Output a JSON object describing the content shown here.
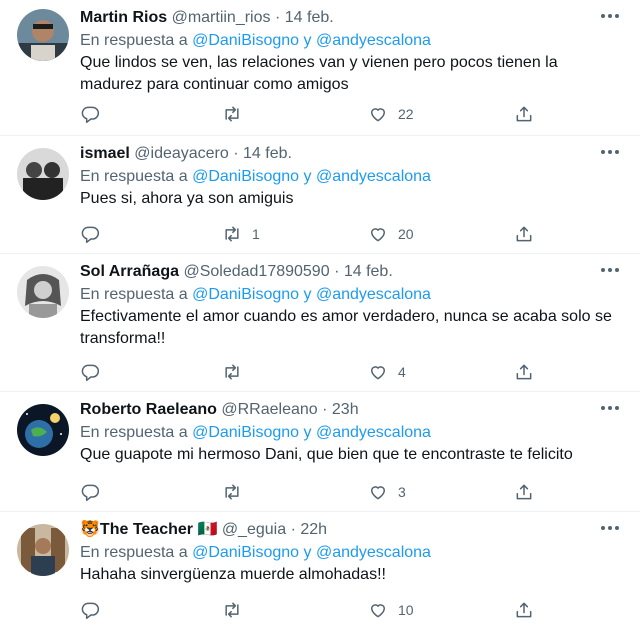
{
  "replies": [
    {
      "name": "Martin Rios",
      "handle": "@martiin_rios",
      "dot": "·",
      "time": "14 feb.",
      "reply_prefix": "En respuesta a",
      "mention1": "@DaniBisogno",
      "reply_and": "y",
      "mention2": "@andyescalona",
      "text": "Que lindos se ven, las relaciones van y vienen pero pocos tienen la madurez para continuar como amigos",
      "retweets": "",
      "likes": "22",
      "avatar_color": "#3a3a3a"
    },
    {
      "name": "ismael",
      "handle": "@ideayacero",
      "dot": "·",
      "time": "14 feb.",
      "reply_prefix": "En respuesta a",
      "mention1": "@DaniBisogno",
      "reply_and": "y",
      "mention2": "@andyescalona",
      "text": "Pues si, ahora ya son amiguis",
      "retweets": "1",
      "likes": "20",
      "avatar_color": "#2b2b2b"
    },
    {
      "name": "Sol Arrañaga",
      "handle": "@Soledad17890590",
      "dot": "·",
      "time": "14 feb.",
      "reply_prefix": "En respuesta a",
      "mention1": "@DaniBisogno",
      "reply_and": "y",
      "mention2": "@andyescalona",
      "text": "Efectivamente el amor cuando es amor verdadero, nunca se acaba solo se transforma!!",
      "retweets": "",
      "likes": "4",
      "avatar_color": "#8a8a8a"
    },
    {
      "name": "Roberto Raeleano",
      "handle": "@RRaeleano",
      "dot": "·",
      "time": "23h",
      "reply_prefix": "En respuesta a",
      "mention1": "@DaniBisogno",
      "reply_and": "y",
      "mention2": "@andyescalona",
      "text": "Que guapote mi hermoso Dani, que bien que te encontraste te felicito",
      "retweets": "",
      "likes": "3",
      "avatar_color": "#0d1b2a"
    },
    {
      "name": "🐯The Teacher 🇲🇽",
      "handle": "@_eguia",
      "dot": "·",
      "time": "22h",
      "reply_prefix": "En respuesta a",
      "mention1": "@DaniBisogno",
      "reply_and": "y",
      "mention2": "@andyescalona",
      "text": "Hahaha sinvergüenza muerde almohadas!!",
      "retweets": "",
      "likes": "10",
      "avatar_color": "#8b6b4a"
    }
  ],
  "colors": {
    "link": "#1d9bf0",
    "secondary": "#536471",
    "text": "#0f1419",
    "divider": "#eff3f4"
  },
  "icons": {
    "more": "more-icon",
    "reply": "reply-icon",
    "retweet": "retweet-icon",
    "like": "like-icon",
    "share": "share-icon"
  }
}
